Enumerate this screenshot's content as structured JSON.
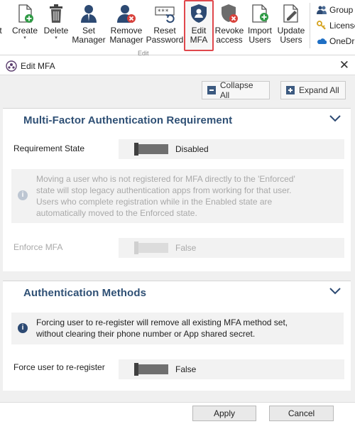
{
  "ribbon": {
    "buttons": [
      {
        "label": "Create",
        "dropdown": true,
        "icon": "create-page-icon"
      },
      {
        "label": "Delete",
        "dropdown": true,
        "icon": "trash-icon"
      },
      {
        "label": "Set\nManager",
        "icon": "set-manager-icon"
      },
      {
        "label": "Remove\nManager",
        "icon": "remove-manager-icon"
      },
      {
        "label": "Reset\nPassword",
        "icon": "reset-password-icon"
      },
      {
        "label": "Edit\nMFA",
        "icon": "shield-user-icon",
        "selected": true
      },
      {
        "label": "Revoke\naccess",
        "icon": "revoke-access-icon"
      },
      {
        "label": "Import\nUsers",
        "dropdown": true,
        "icon": "import-users-icon"
      },
      {
        "label": "Update\nUsers",
        "dropdown": true,
        "icon": "update-users-icon"
      }
    ],
    "group_label": "Edit",
    "side_items": [
      "Group",
      "License",
      "OneDri"
    ]
  },
  "dialog": {
    "title": "Edit MFA",
    "collapse_all": "Collapse All",
    "expand_all": "Expand All",
    "sections": {
      "mfa": {
        "title": "Multi-Factor Authentication Requirement",
        "requirement_label": "Requirement State",
        "requirement_value": "Disabled",
        "note": "Moving a user who is not registered for MFA directly to the 'Enforced' state will stop legacy authentication apps from working for that user. Users who complete registration while in the Enabled state are automatically moved to the Enforced state.",
        "enforce_label": "Enforce MFA",
        "enforce_value": "False"
      },
      "auth": {
        "title": "Authentication Methods",
        "note": "Forcing user to re-register will remove all existing MFA method set, without clearing their phone number or App shared secret.",
        "force_label": "Force user to re-register",
        "force_value": "False"
      }
    },
    "apply_label": "Apply",
    "cancel_label": "Cancel"
  },
  "colors": {
    "accent": "#2d4a73",
    "selected_border": "#e0474c"
  }
}
